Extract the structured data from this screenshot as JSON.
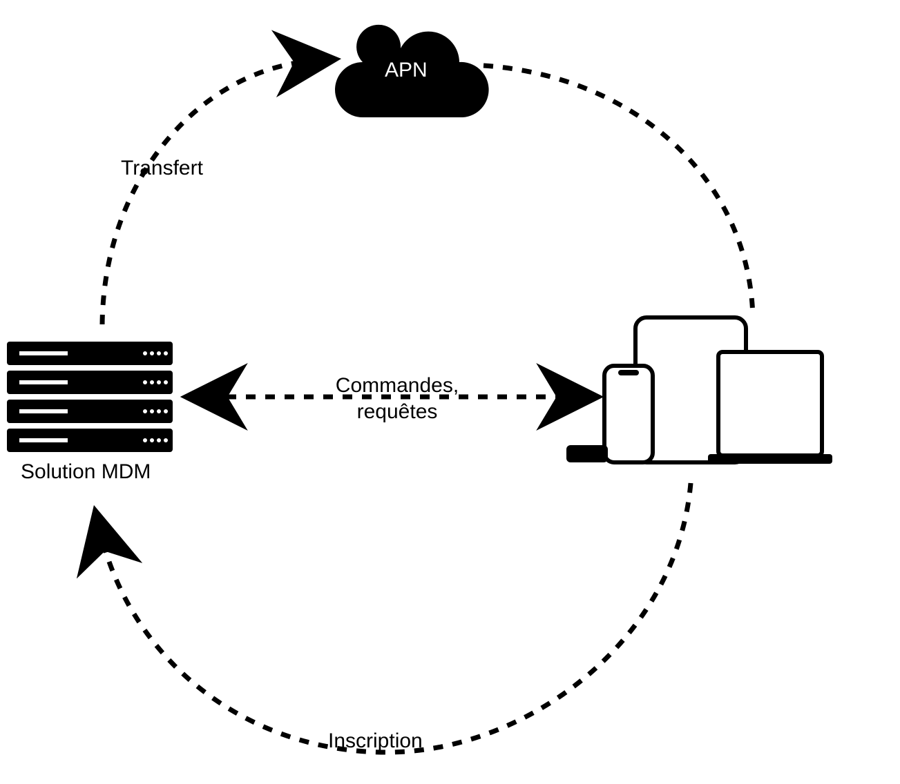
{
  "nodes": {
    "cloud": {
      "label": "APN"
    },
    "server": {
      "label": "Solution MDM"
    }
  },
  "edges": {
    "transfer": {
      "label": "Transfert"
    },
    "commands": {
      "label": "Commandes,\nrequêtes"
    },
    "enroll": {
      "label": "Inscription"
    }
  }
}
